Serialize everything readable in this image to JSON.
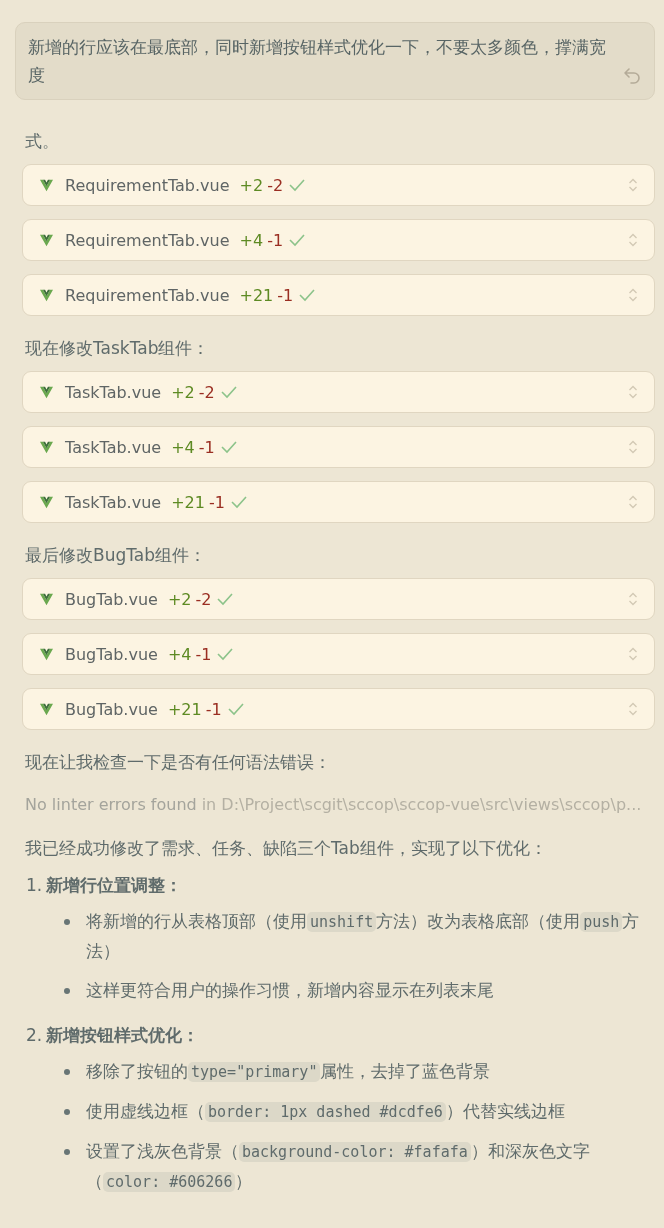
{
  "user_message": {
    "text": "新增的行应该在最底部，同时新增按钮样式优化一下，不要太多颜色，撑满宽度"
  },
  "blocks": [
    {
      "kind": "para",
      "text": "式。"
    },
    {
      "kind": "file",
      "file": "RequirementTab.vue",
      "added": "+2",
      "removed": "-2",
      "applied": true
    },
    {
      "kind": "file",
      "file": "RequirementTab.vue",
      "added": "+4",
      "removed": "-1",
      "applied": true
    },
    {
      "kind": "file",
      "file": "RequirementTab.vue",
      "added": "+21",
      "removed": "-1",
      "applied": true
    },
    {
      "kind": "para",
      "text": "现在修改TaskTab组件："
    },
    {
      "kind": "file",
      "file": "TaskTab.vue",
      "added": "+2",
      "removed": "-2",
      "applied": true
    },
    {
      "kind": "file",
      "file": "TaskTab.vue",
      "added": "+4",
      "removed": "-1",
      "applied": true
    },
    {
      "kind": "file",
      "file": "TaskTab.vue",
      "added": "+21",
      "removed": "-1",
      "applied": true
    },
    {
      "kind": "para",
      "text": "最后修改BugTab组件："
    },
    {
      "kind": "file",
      "file": "BugTab.vue",
      "added": "+2",
      "removed": "-2",
      "applied": true
    },
    {
      "kind": "file",
      "file": "BugTab.vue",
      "added": "+4",
      "removed": "-1",
      "applied": true
    },
    {
      "kind": "file",
      "file": "BugTab.vue",
      "added": "+21",
      "removed": "-1",
      "applied": true
    },
    {
      "kind": "para",
      "text": "现在让我检查一下是否有任何语法错误："
    },
    {
      "kind": "lint",
      "status": "No linter errors found",
      "path": "in D:\\Project\\scgit\\sccop\\sccop-vue\\src\\views\\sccop\\p..."
    },
    {
      "kind": "para",
      "text": "我已经成功修改了需求、任务、缺陷三个Tab组件，实现了以下优化："
    },
    {
      "kind": "list",
      "items": [
        {
          "number": "1.",
          "title": "新增行位置调整：",
          "bullets": [
            [
              {
                "kind": "text",
                "text": "将新增的行从表格顶部（使用"
              },
              {
                "kind": "code",
                "text": "unshift"
              },
              {
                "kind": "text",
                "text": "方法）改为表格底部（使用"
              },
              {
                "kind": "code",
                "text": "push"
              },
              {
                "kind": "text",
                "text": "方法）"
              }
            ],
            [
              {
                "kind": "text",
                "text": "这样更符合用户的操作习惯，新增内容显示在列表末尾"
              }
            ]
          ]
        },
        {
          "number": "2.",
          "title": "新增按钮样式优化：",
          "bullets": [
            [
              {
                "kind": "text",
                "text": "移除了按钮的"
              },
              {
                "kind": "code",
                "text": "type=\"primary\""
              },
              {
                "kind": "text",
                "text": "属性，去掉了蓝色背景"
              }
            ],
            [
              {
                "kind": "text",
                "text": "使用虚线边框（"
              },
              {
                "kind": "code",
                "text": "border: 1px dashed #dcdfe6"
              },
              {
                "kind": "text",
                "text": "）代替实线边框"
              }
            ],
            [
              {
                "kind": "text",
                "text": "设置了浅灰色背景（"
              },
              {
                "kind": "code",
                "text": "background-color: #fafafa"
              },
              {
                "kind": "text",
                "text": "）和深灰色文字（"
              },
              {
                "kind": "code",
                "text": "color: #606266"
              },
              {
                "kind": "text",
                "text": "）"
              }
            ]
          ]
        }
      ]
    }
  ]
}
